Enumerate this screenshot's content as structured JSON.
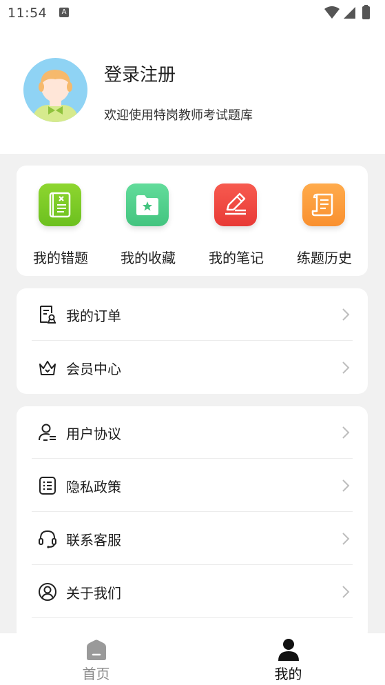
{
  "status_bar": {
    "time": "11:54",
    "notification_letter": "A"
  },
  "profile": {
    "title": "登录注册",
    "subtitle": "欢迎使用特岗教师考试题库"
  },
  "quick_actions": [
    {
      "label": "我的错题",
      "icon": "wrong-questions-icon",
      "color": "#7ccb2a"
    },
    {
      "label": "我的收藏",
      "icon": "favorites-folder-icon",
      "color": "#4fcf8c"
    },
    {
      "label": "我的笔记",
      "icon": "notes-pen-icon",
      "color": "#f2433f"
    },
    {
      "label": "练题历史",
      "icon": "history-scroll-icon",
      "color": "#fb9a3b"
    }
  ],
  "menu_group_1": [
    {
      "label": "我的订单",
      "icon": "order-receipt-icon"
    },
    {
      "label": "会员中心",
      "icon": "crown-icon"
    }
  ],
  "menu_group_2": [
    {
      "label": "用户协议",
      "icon": "user-agreement-icon"
    },
    {
      "label": "隐私政策",
      "icon": "privacy-list-icon"
    },
    {
      "label": "联系客服",
      "icon": "headset-icon"
    },
    {
      "label": "关于我们",
      "icon": "about-user-icon"
    }
  ],
  "tabbar": [
    {
      "label": "首页",
      "icon": "home-icon",
      "active": false
    },
    {
      "label": "我的",
      "icon": "profile-icon",
      "active": true
    }
  ],
  "colors": {
    "active_tab": "#111111",
    "inactive_tab": "#8a8a8a"
  }
}
